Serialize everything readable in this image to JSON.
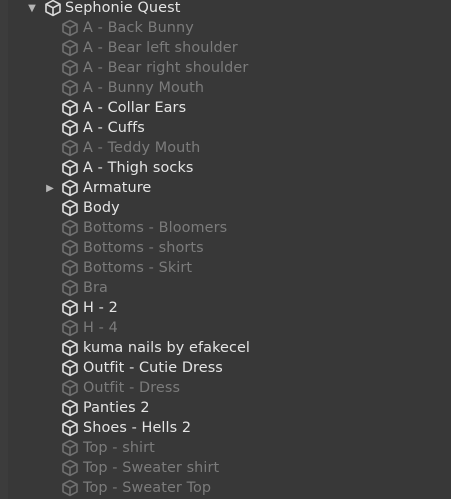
{
  "hierarchy": {
    "root": {
      "label": "Sephonie Quest",
      "expanded": true
    },
    "items": [
      {
        "label": "A - Back Bunny",
        "active": false,
        "has_children": false
      },
      {
        "label": "A - Bear left shoulder",
        "active": false,
        "has_children": false
      },
      {
        "label": "A - Bear right shoulder",
        "active": false,
        "has_children": false
      },
      {
        "label": "A - Bunny Mouth",
        "active": false,
        "has_children": false
      },
      {
        "label": "A - Collar Ears",
        "active": true,
        "has_children": false
      },
      {
        "label": "A - Cuffs",
        "active": true,
        "has_children": false
      },
      {
        "label": "A - Teddy Mouth",
        "active": false,
        "has_children": false
      },
      {
        "label": "A - Thigh socks",
        "active": true,
        "has_children": false
      },
      {
        "label": "Armature",
        "active": true,
        "has_children": true
      },
      {
        "label": "Body",
        "active": true,
        "has_children": false
      },
      {
        "label": "Bottoms - Bloomers",
        "active": false,
        "has_children": false
      },
      {
        "label": "Bottoms - shorts",
        "active": false,
        "has_children": false
      },
      {
        "label": "Bottoms - Skirt",
        "active": false,
        "has_children": false
      },
      {
        "label": "Bra",
        "active": false,
        "has_children": false
      },
      {
        "label": "H - 2",
        "active": true,
        "has_children": false
      },
      {
        "label": "H - 4",
        "active": false,
        "has_children": false
      },
      {
        "label": "kuma nails by efakecel",
        "active": true,
        "has_children": false
      },
      {
        "label": "Outfit - Cutie Dress",
        "active": true,
        "has_children": false
      },
      {
        "label": "Outfit - Dress",
        "active": false,
        "has_children": false
      },
      {
        "label": "Panties 2",
        "active": true,
        "has_children": false
      },
      {
        "label": "Shoes - Hells 2",
        "active": true,
        "has_children": false
      },
      {
        "label": "Top - shirt",
        "active": false,
        "has_children": false
      },
      {
        "label": "Top - Sweater shirt",
        "active": false,
        "has_children": false
      },
      {
        "label": "Top - Sweater Top",
        "active": false,
        "has_children": false
      }
    ]
  },
  "colors": {
    "background": "#383838",
    "text_active": "#e4e4e4",
    "text_inactive": "#7b7b7b",
    "icon_active": "#dcdcdc",
    "icon_inactive": "#707070"
  },
  "icons": {
    "object": "cube-icon",
    "expanded": "triangle-down-icon",
    "collapsed": "triangle-right-icon"
  }
}
